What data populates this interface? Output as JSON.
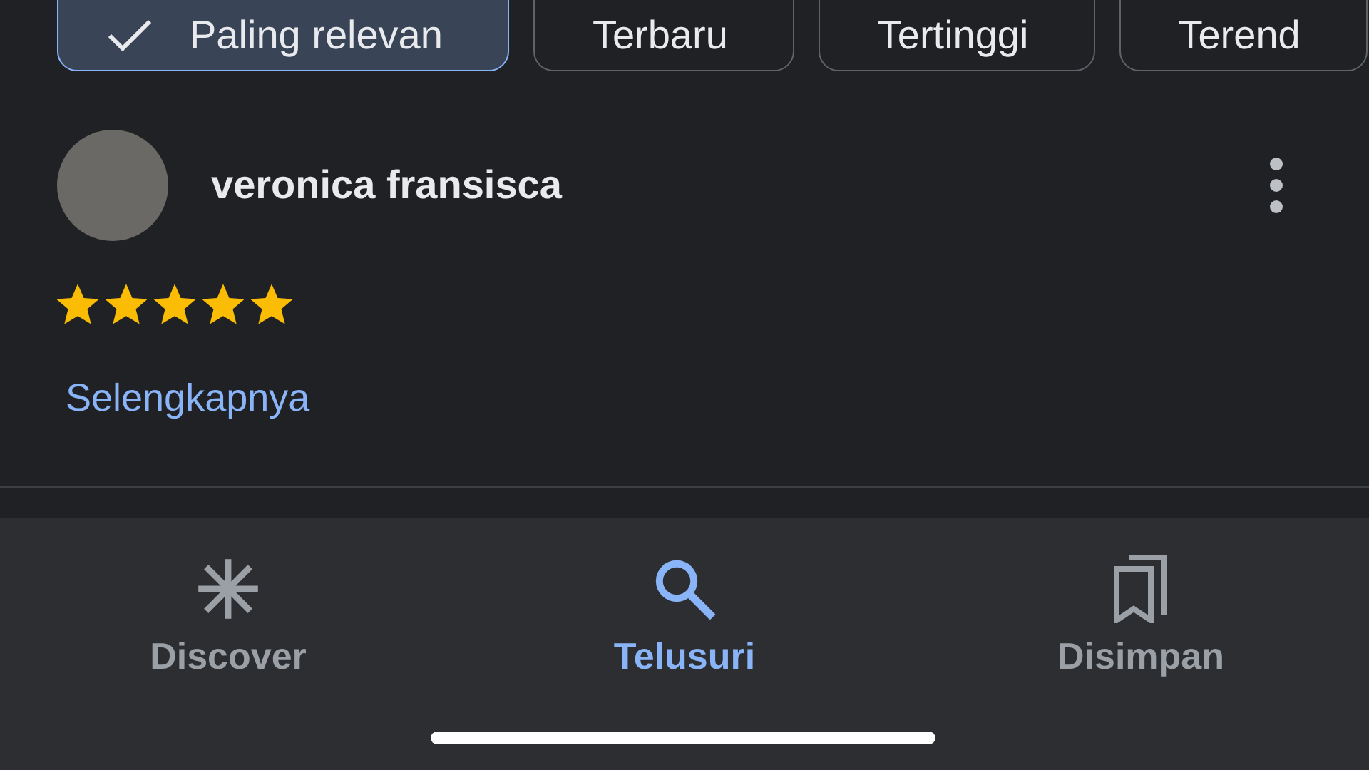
{
  "filters": [
    {
      "label": "Paling relevan",
      "selected": true
    },
    {
      "label": "Terbaru",
      "selected": false
    },
    {
      "label": "Tertinggi",
      "selected": false
    },
    {
      "label": "Terend",
      "selected": false
    }
  ],
  "review": {
    "author": "veronica fransisca",
    "stars": 5,
    "more_link": "Selengkapnya"
  },
  "nav": [
    {
      "label": "Discover",
      "selected": false
    },
    {
      "label": "Telusuri",
      "selected": true
    },
    {
      "label": "Disimpan",
      "selected": false
    }
  ]
}
